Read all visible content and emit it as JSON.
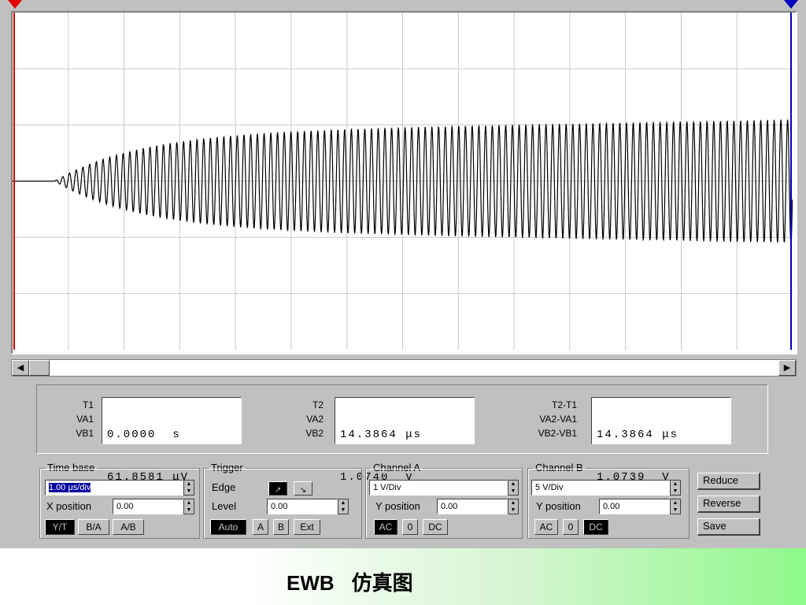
{
  "scope": {
    "markers": {
      "t1": "1",
      "t2": "2"
    },
    "colors": {
      "trace": "#000000",
      "cursor1": "#e00000",
      "cursor2": "#0000c0",
      "grid": "#c8c8c8"
    },
    "waveform": {
      "type": "growing-oscillation",
      "start_division": 0.75,
      "settled_amplitude_divisions": 1.1,
      "cycles": 110
    }
  },
  "readouts": {
    "t1": {
      "labels": [
        "T1",
        "VA1",
        "VB1"
      ],
      "line1": "0.0000  s",
      "line2": "61.8581 μV"
    },
    "t2": {
      "labels": [
        "T2",
        "VA2",
        "VB2"
      ],
      "line1": "14.3864 μs",
      "line2": "1.0740  V"
    },
    "diff": {
      "labels": [
        "T2-T1",
        "VA2-VA1",
        "VB2-VB1"
      ],
      "line1": "14.3864 μs",
      "line2": "1.0739  V"
    }
  },
  "timebase": {
    "title": "Time base",
    "value": "1.00 μs/div",
    "xpos_label": "X position",
    "xpos_value": "0.00",
    "modes": [
      "Y/T",
      "B/A",
      "A/B"
    ],
    "active_mode": "Y/T"
  },
  "trigger": {
    "title": "Trigger",
    "edge_label": "Edge",
    "level_label": "Level",
    "level_value": "0.00",
    "sources": [
      "Auto",
      "A",
      "B",
      "Ext"
    ],
    "active_source": "Auto"
  },
  "channel_a": {
    "title": "Channel A",
    "scale": "1 V/Div",
    "ypos_label": "Y position",
    "ypos_value": "0.00",
    "coupling": [
      "AC",
      "0",
      "DC"
    ],
    "active": "AC"
  },
  "channel_b": {
    "title": "Channel B",
    "scale": "5 V/Div",
    "ypos_label": "Y position",
    "ypos_value": "0.00",
    "coupling": [
      "AC",
      "0",
      "DC"
    ],
    "active": "DC"
  },
  "actions": {
    "reduce": "Reduce",
    "reverse": "Reverse",
    "save": "Save"
  },
  "caption": {
    "part1": "EWB",
    "part2": "仿真图"
  }
}
